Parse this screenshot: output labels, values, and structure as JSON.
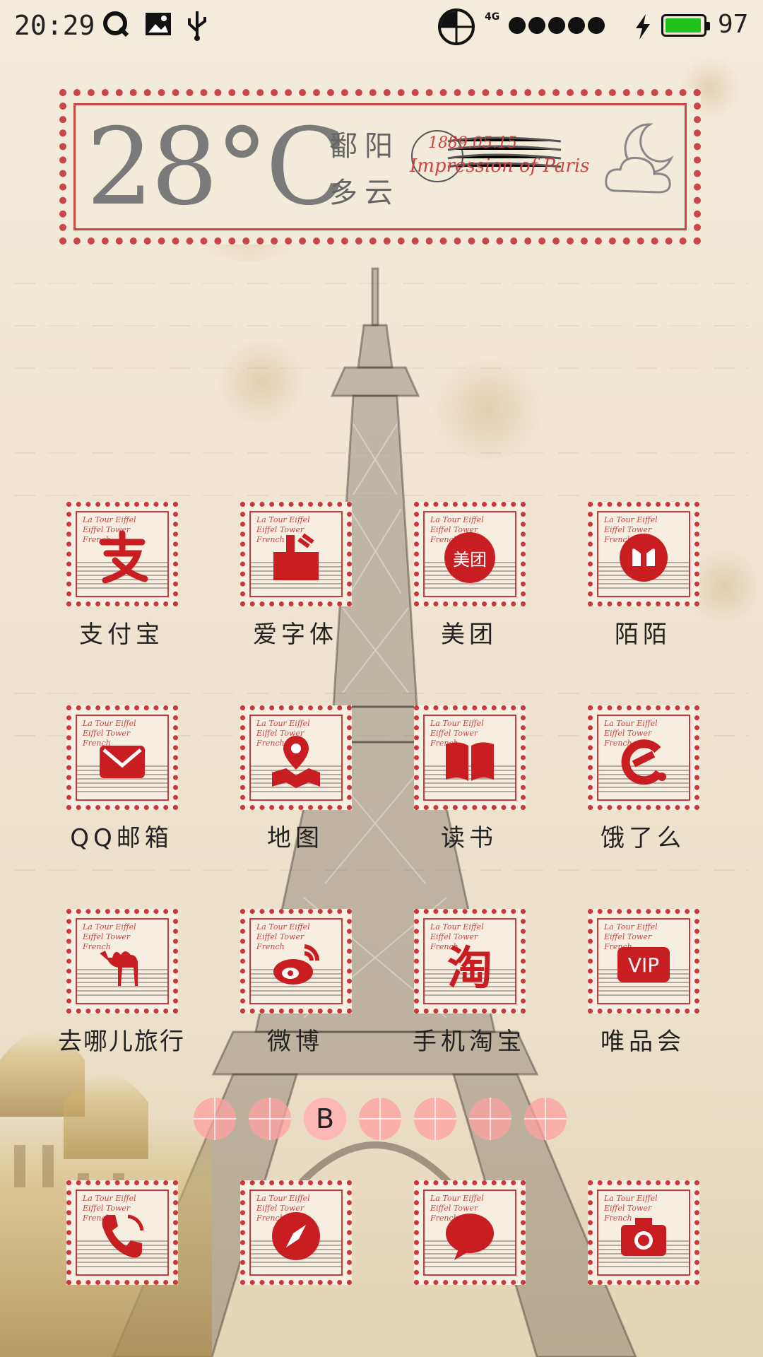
{
  "status_bar": {
    "time": "20:29",
    "network": "4G",
    "battery_percent": "97",
    "battery_level": 0.97,
    "icons": [
      "q-icon",
      "image-icon",
      "usb-icon",
      "vpn-target-icon",
      "signal-icon",
      "charging-icon",
      "battery-icon"
    ]
  },
  "weather": {
    "temperature": "28°C",
    "city": "鄱阳",
    "condition": "多云",
    "postmark_date": "1889.05.15",
    "postmark_text": "Impression of Paris",
    "icon": "cloudy-night-icon"
  },
  "stamp_text": [
    "La Tour Eiffel",
    "Eiffel Tower",
    "French"
  ],
  "apps": [
    {
      "label": "支付宝",
      "icon": "alipay-icon"
    },
    {
      "label": "爱字体",
      "icon": "font-icon"
    },
    {
      "label": "美团",
      "icon": "meituan-icon",
      "badge": "美团"
    },
    {
      "label": "陌陌",
      "icon": "momo-icon"
    },
    {
      "label": "QQ邮箱",
      "icon": "mail-icon"
    },
    {
      "label": "地图",
      "icon": "map-icon"
    },
    {
      "label": "读书",
      "icon": "book-icon"
    },
    {
      "label": "饿了么",
      "icon": "eleme-icon"
    },
    {
      "label": "去哪儿旅行",
      "icon": "camel-icon"
    },
    {
      "label": "微博",
      "icon": "weibo-icon"
    },
    {
      "label": "手机淘宝",
      "icon": "taobao-icon",
      "badge": "淘"
    },
    {
      "label": "唯品会",
      "icon": "vip-icon",
      "badge": "VIP"
    }
  ],
  "page_indicator": {
    "active_label": "B",
    "active_index": 2,
    "count": 7
  },
  "dock": [
    {
      "icon": "phone-icon"
    },
    {
      "icon": "compass-icon"
    },
    {
      "icon": "message-icon"
    },
    {
      "icon": "camera-icon"
    }
  ],
  "colors": {
    "accent": "#c8383c",
    "battery": "#22c21e",
    "paper": "#f4ecdc"
  }
}
